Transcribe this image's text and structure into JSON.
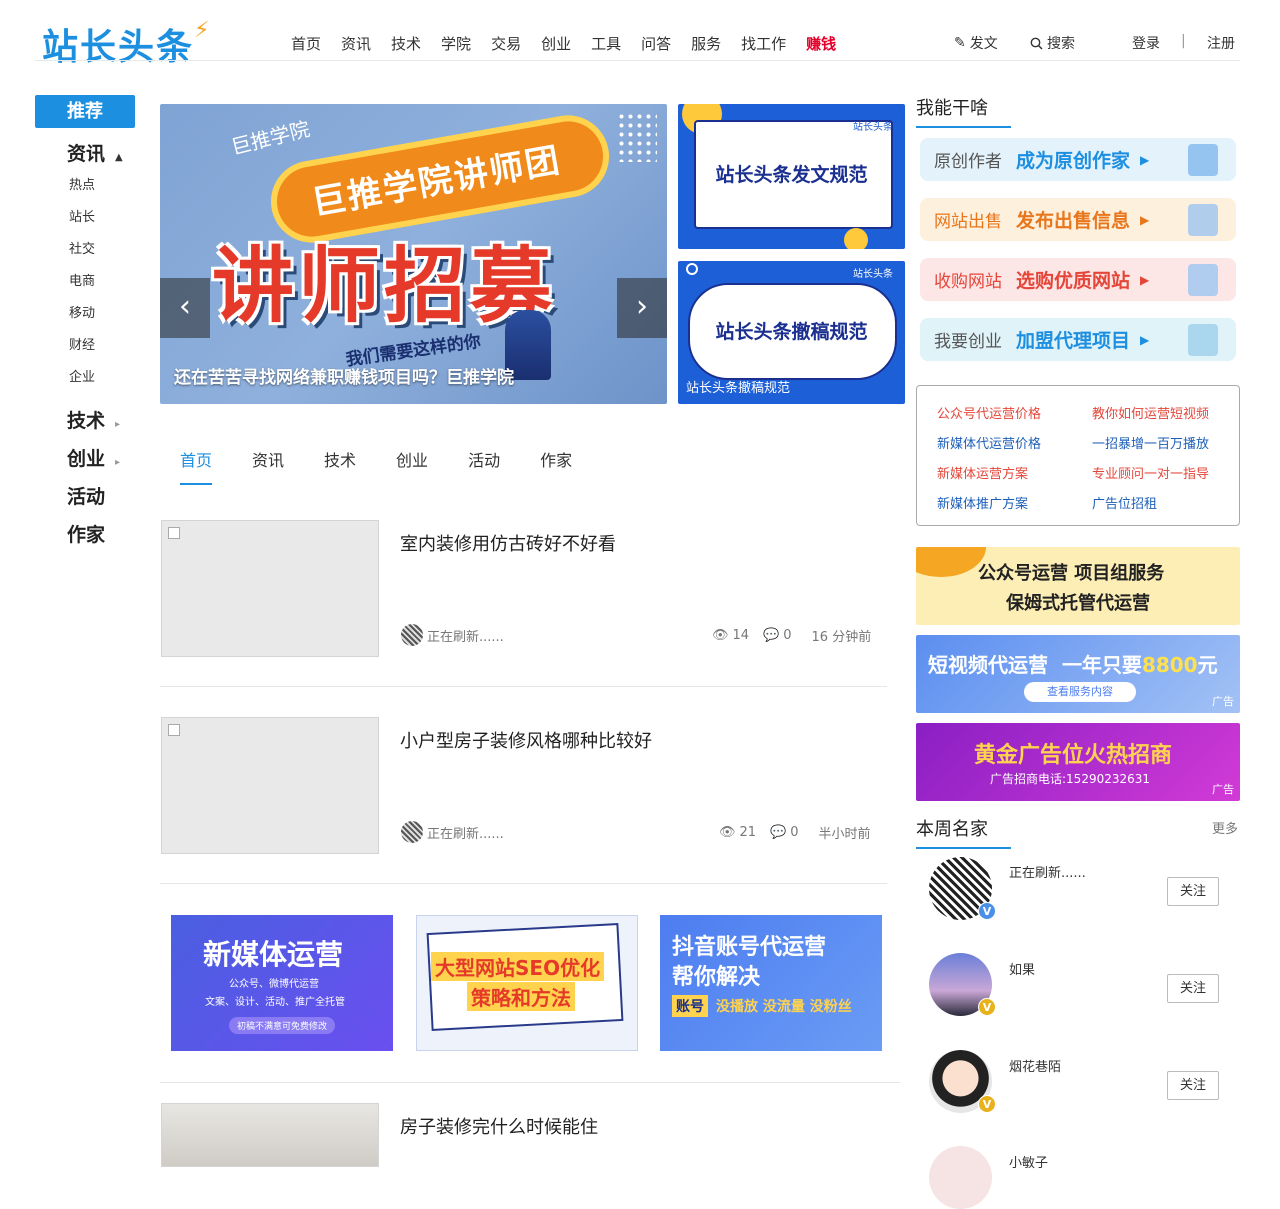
{
  "header": {
    "logo": "站长头条",
    "nav": [
      "首页",
      "资讯",
      "技术",
      "学院",
      "交易",
      "创业",
      "工具",
      "问答",
      "服务",
      "找工作",
      "赚钱"
    ],
    "post": "发文",
    "search": "搜索",
    "login": "登录",
    "divider": "|",
    "register": "注册"
  },
  "left_nav": {
    "recommend": "推荐",
    "news": "资讯",
    "news_items": [
      "热点",
      "站长",
      "社交",
      "电商",
      "移动",
      "财经",
      "企业"
    ],
    "tech": "技术",
    "startup": "创业",
    "activity": "活动",
    "author": "作家"
  },
  "banner": {
    "brand": "巨推学院",
    "ribbon": "巨推学院讲师团",
    "headline": "讲师招募",
    "sub": "我们需要这样的你",
    "caption": "还在苦苦寻找网络兼职赚钱项目吗？巨推学院",
    "prev": "‹",
    "next": "›"
  },
  "side_banners": [
    {
      "title": "站长头条发文规范",
      "mini": "站长头条"
    },
    {
      "title": "站长头条撤稿规范",
      "mini": "站长头条",
      "caption": "站长头条撤稿规范"
    }
  ],
  "tabs": [
    "首页",
    "资讯",
    "技术",
    "创业",
    "活动",
    "作家"
  ],
  "articles": [
    {
      "title": "室内装修用仿古砖好不好看",
      "author": "正在刷新......",
      "views": "14",
      "comments": "0",
      "time": "16 分钟前"
    },
    {
      "title": "小户型房子装修风格哪种比较好",
      "author": "正在刷新......",
      "views": "21",
      "comments": "0",
      "time": "半小时前"
    },
    {
      "title": "房子装修完什么时候能住"
    }
  ],
  "ads_row": [
    {
      "t1": "新媒体运营",
      "t2": "公众号、微博代运营",
      "t3": "文案、设计、活动、推广全托管",
      "t4": "初稿不满意可免费修改"
    },
    {
      "t1": "大型网站SEO优化",
      "t2": "策略和方法"
    },
    {
      "t1": "抖音账号代运营",
      "t2": "帮你解决",
      "t3": "账号",
      "t4": "没播放 没流量 没粉丝"
    }
  ],
  "right": {
    "what_title": "我能干啥",
    "buttons": [
      {
        "l1": "原创作者",
        "l2": "成为原创作家",
        "color": "#1d8fe0",
        "bg": "#e3f2fb"
      },
      {
        "l1": "网站出售",
        "l2": "发布出售信息",
        "color": "#e8761c",
        "bg": "#fdf1dd"
      },
      {
        "l1": "收购网站",
        "l2": "选购优质网站",
        "color": "#e4463a",
        "bg": "#fde6e6"
      },
      {
        "l1": "我要创业",
        "l2": "加盟代理项目",
        "color": "#1d8fe0",
        "bg": "#e0f3f9"
      }
    ],
    "links": [
      [
        "公众号代运营价格",
        "教你如何运营短视频"
      ],
      [
        "新媒体代运营价格",
        "一招暴增一百万播放"
      ],
      [
        "新媒体运营方案",
        "专业顾问一对一指导"
      ],
      [
        "新媒体推广方案",
        "广告位招租"
      ]
    ],
    "ad1": {
      "l1": "公众号运营  项目组服务",
      "l2": "保姆式托管代运营"
    },
    "ad2": {
      "l1": "短视频代运营",
      "l2": "一年只要",
      "price": "8800",
      "unit": "元",
      "btn": "查看服务内容",
      "tag": "广告"
    },
    "ad3": {
      "l1": "黄金广告位火热招商",
      "l2": "广告招商电话:15290232631",
      "tag": "广告"
    },
    "week_title": "本周名家",
    "more": "更多",
    "authors": [
      {
        "name": "正在刷新......",
        "follow": "关注",
        "badge": "V"
      },
      {
        "name": "如果",
        "follow": "关注",
        "badge": "V"
      },
      {
        "name": "烟花巷陌",
        "follow": "关注",
        "badge": "V"
      },
      {
        "name": "小敏子"
      }
    ]
  }
}
